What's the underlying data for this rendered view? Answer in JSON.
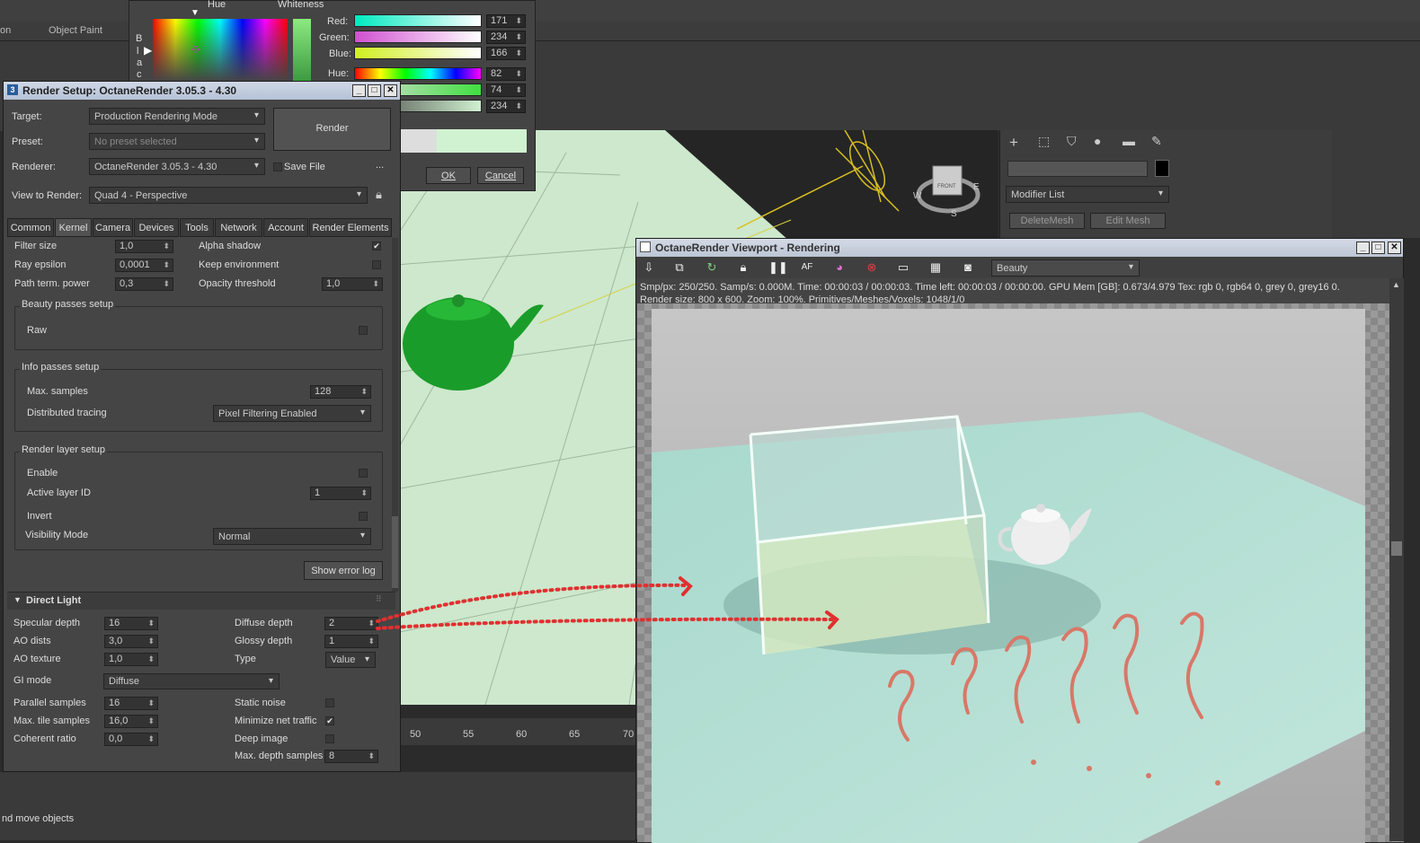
{
  "menubar": {
    "items": [
      "on",
      "Object Paint"
    ]
  },
  "color_picker": {
    "hue_label": "Hue",
    "whiteness_label": "Whiteness",
    "blackness_letters": [
      "B",
      "l",
      "a",
      "c"
    ],
    "channels": [
      {
        "label": "Red:",
        "value": "171"
      },
      {
        "label": "Green:",
        "value": "234"
      },
      {
        "label": "Blue:",
        "value": "166"
      },
      {
        "label": "Hue:",
        "value": "82"
      },
      {
        "label": "",
        "value": "74"
      },
      {
        "label": "",
        "value": "234"
      }
    ],
    "ok_label": "OK",
    "cancel_label": "Cancel"
  },
  "render_setup": {
    "title": "Render Setup: OctaneRender 3.05.3 - 4.30",
    "target_label": "Target:",
    "target_value": "Production Rendering Mode",
    "preset_label": "Preset:",
    "preset_value": "No preset selected",
    "renderer_label": "Renderer:",
    "renderer_value": "OctaneRender 3.05.3 - 4.30",
    "save_file_label": "Save File",
    "ellipsis": "...",
    "render_button": "Render",
    "view_label": "View to Render:",
    "view_value": "Quad 4 - Perspective",
    "tabs": [
      "Common",
      "Kernel",
      "Camera",
      "Devices",
      "Tools",
      "Network",
      "Account",
      "Render Elements"
    ],
    "rows_top": [
      {
        "label": "Filter size",
        "value": "1,0",
        "right_label": "Alpha shadow",
        "right_check": "✔"
      },
      {
        "label": "Ray epsilon",
        "value": "0,0001",
        "right_label": "Keep environment",
        "right_check": ""
      },
      {
        "label": "Path term. power",
        "value": "0,3",
        "right_label": "Opacity threshold",
        "right_value": "1,0"
      }
    ],
    "beauty_group": "Beauty passes setup",
    "raw_label": "Raw",
    "info_group": "Info passes setup",
    "max_samples_label": "Max. samples",
    "max_samples_value": "128",
    "distributed_label": "Distributed tracing",
    "distributed_value": "Pixel Filtering Enabled",
    "layer_group": "Render layer setup",
    "enable_label": "Enable",
    "active_layer_label": "Active layer ID",
    "active_layer_value": "1",
    "invert_label": "Invert",
    "visibility_label": "Visibility Mode",
    "visibility_value": "Normal",
    "show_error_log": "Show error log",
    "direct_light_header": "Direct Light",
    "dl_left": [
      {
        "label": "Specular depth",
        "value": "16"
      },
      {
        "label": "AO dists",
        "value": "3,0"
      },
      {
        "label": "AO texture",
        "value": "1,0"
      }
    ],
    "dl_right": [
      {
        "label": "Diffuse depth",
        "value": "2"
      },
      {
        "label": "Glossy depth",
        "value": "1"
      },
      {
        "label": "Type",
        "value": "Value"
      }
    ],
    "gi_label": "GI mode",
    "gi_value": "Diffuse",
    "dl_left2": [
      {
        "label": "Parallel samples",
        "value": "16"
      },
      {
        "label": "Max. tile samples",
        "value": "16,0"
      },
      {
        "label": "Coherent ratio",
        "value": "0,0"
      }
    ],
    "dl_right2": [
      {
        "label": "Static noise",
        "check": ""
      },
      {
        "label": "Minimize net traffic",
        "check": "✔"
      },
      {
        "label": "Deep image",
        "check": ""
      }
    ],
    "max_depth_label": "Max. depth samples",
    "max_depth_value": "8"
  },
  "command_panel": {
    "modifier_list": "Modifier List",
    "delete_mesh": "DeleteMesh",
    "edit_mesh": "Edit Mesh"
  },
  "timeline": {
    "ticks": [
      "50",
      "55",
      "60",
      "65",
      "70"
    ]
  },
  "status": {
    "text": "nd move objects"
  },
  "octane": {
    "title": "OctaneRender Viewport - Rendering",
    "pass_value": "Beauty",
    "stats_line1": "Smp/px: 250/250.   Samp/s: 0.000M.   Time: 00:00:03 / 00:00:03.   Time left: 00:00:03 / 00:00:00.   GPU Mem [GB]: 0.673/4.979   Tex: rgb 0, rgb64 0, grey 0, grey16 0.",
    "stats_line2": "Render size: 800 x 600.   Zoom: 100%.   Primitives/Meshes/Voxels: 1048/1/0"
  },
  "viewcube": {
    "face": "FRONT",
    "compass": [
      "W",
      "S",
      "E"
    ]
  }
}
